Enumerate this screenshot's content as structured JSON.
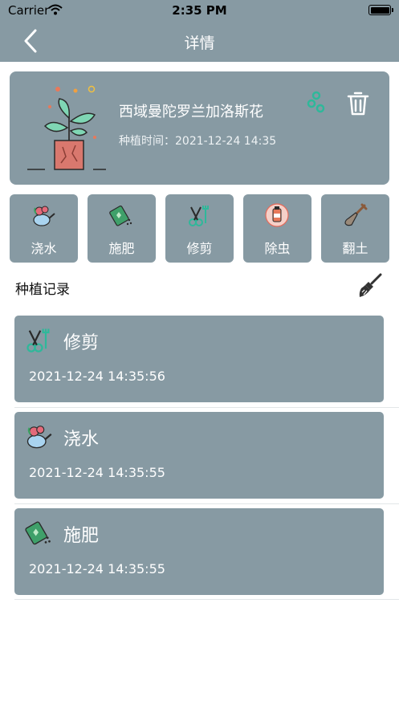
{
  "status_bar": {
    "carrier": "Carrier",
    "time": "2:35 PM"
  },
  "nav": {
    "title": "详情"
  },
  "plant": {
    "name": "西域曼陀罗兰加洛斯花",
    "time_label": "种植时间：",
    "time_value": "2021-12-24 14:35"
  },
  "actions": [
    {
      "label": "浇水",
      "icon": "watering-can-icon"
    },
    {
      "label": "施肥",
      "icon": "fertilizer-bag-icon"
    },
    {
      "label": "修剪",
      "icon": "pruning-shears-icon"
    },
    {
      "label": "除虫",
      "icon": "pesticide-spray-icon"
    },
    {
      "label": "翻土",
      "icon": "shovel-icon"
    }
  ],
  "records": {
    "header": "种植记录",
    "items": [
      {
        "title": "修剪",
        "time": "2021-12-24 14:35:56",
        "icon": "pruning-shears-icon"
      },
      {
        "title": "浇水",
        "time": "2021-12-24 14:35:55",
        "icon": "watering-can-icon"
      },
      {
        "title": "施肥",
        "time": "2021-12-24 14:35:55",
        "icon": "fertilizer-bag-icon"
      }
    ]
  },
  "colors": {
    "card": "#879aa3",
    "accent_green": "#2fb89a",
    "pot": "#d9786e"
  }
}
